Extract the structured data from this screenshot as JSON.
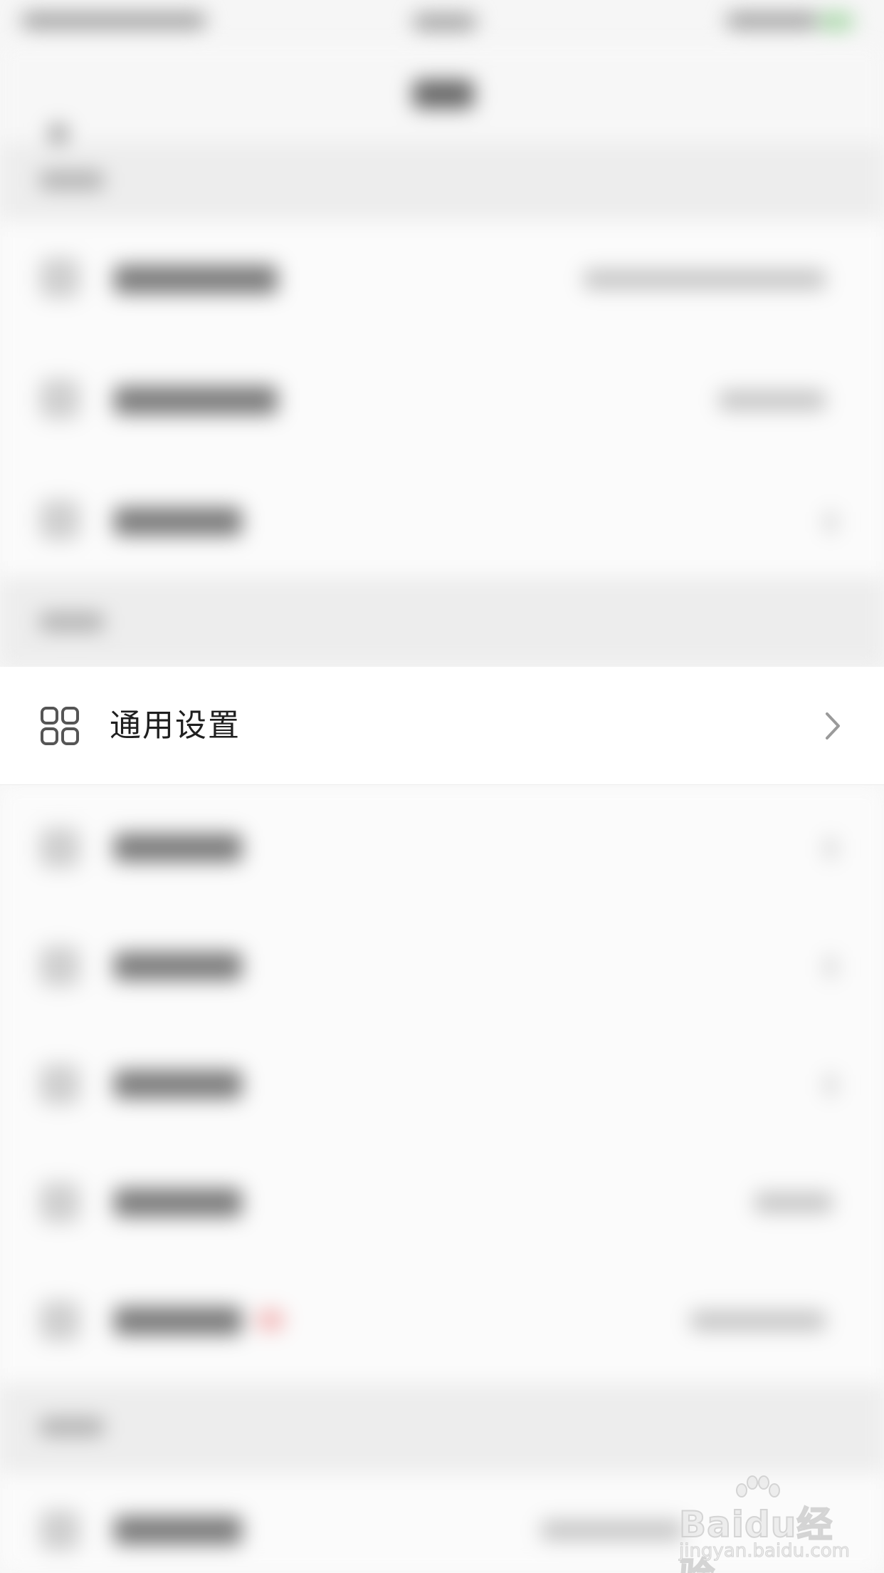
{
  "focused_row": {
    "label": "通用设置",
    "icon": "grid-icon",
    "chevron": "chevron-right-icon"
  },
  "watermark": {
    "brand": "Baidu经验",
    "url": "jingyan.baidu.com"
  },
  "colors": {
    "row_background": "#ffffff",
    "page_background": "#f6f6f6",
    "label_text": "#1f1f1f",
    "icon_stroke": "#555555",
    "chevron": "#9a9a9a"
  }
}
